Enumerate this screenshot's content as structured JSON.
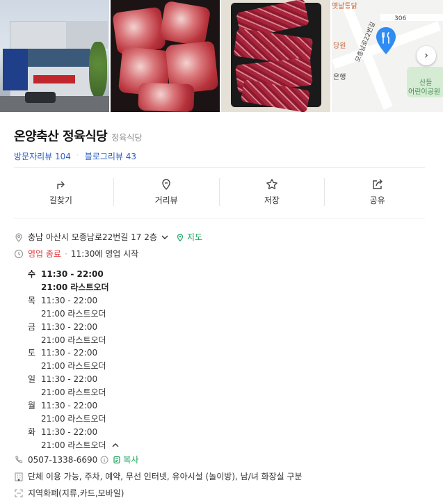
{
  "gallery": {
    "map": {
      "labels": [
        "옛날통닭",
        "306",
        "당원",
        "모종남로22번길",
        "은행",
        "산들",
        "어린이공원"
      ]
    }
  },
  "place": {
    "name": "온양축산 정육식당",
    "category": "정육식당",
    "visitor_reviews": "방문자리뷰 104",
    "blog_reviews": "블로그리뷰 43"
  },
  "actions": [
    {
      "label": "길찾기",
      "icon": "directions-icon"
    },
    {
      "label": "거리뷰",
      "icon": "street-view-icon"
    },
    {
      "label": "저장",
      "icon": "star-icon"
    },
    {
      "label": "공유",
      "icon": "share-icon"
    }
  ],
  "address": {
    "text": "충남 아산시 모종남로22번길 17 2층",
    "map_link": "지도"
  },
  "status": {
    "state": "영업 종료",
    "next": "11:30에 영업 시작"
  },
  "hours": [
    {
      "day": "수",
      "time": "11:30 - 22:00",
      "last_order": "21:00 라스트오더",
      "today": true
    },
    {
      "day": "목",
      "time": "11:30 - 22:00",
      "last_order": "21:00 라스트오더"
    },
    {
      "day": "금",
      "time": "11:30 - 22:00",
      "last_order": "21:00 라스트오더"
    },
    {
      "day": "토",
      "time": "11:30 - 22:00",
      "last_order": "21:00 라스트오더"
    },
    {
      "day": "일",
      "time": "11:30 - 22:00",
      "last_order": "21:00 라스트오더"
    },
    {
      "day": "월",
      "time": "11:30 - 22:00",
      "last_order": "21:00 라스트오더"
    },
    {
      "day": "화",
      "time": "11:30 - 22:00",
      "last_order": "21:00 라스트오더"
    }
  ],
  "phone": {
    "number": "0507-1338-6690",
    "copy_label": "복사"
  },
  "facilities": "단체 이용 가능, 주차, 예약, 무선 인터넷, 유아시설 (놀이방), 남/녀 화장실 구분",
  "payment": "지역화폐(지류,카드,모바일)",
  "colors": {
    "link_blue": "#2b5fc6",
    "green": "#1aa35c",
    "closed_red": "#e0383e",
    "map_pin": "#2f8cf3"
  }
}
